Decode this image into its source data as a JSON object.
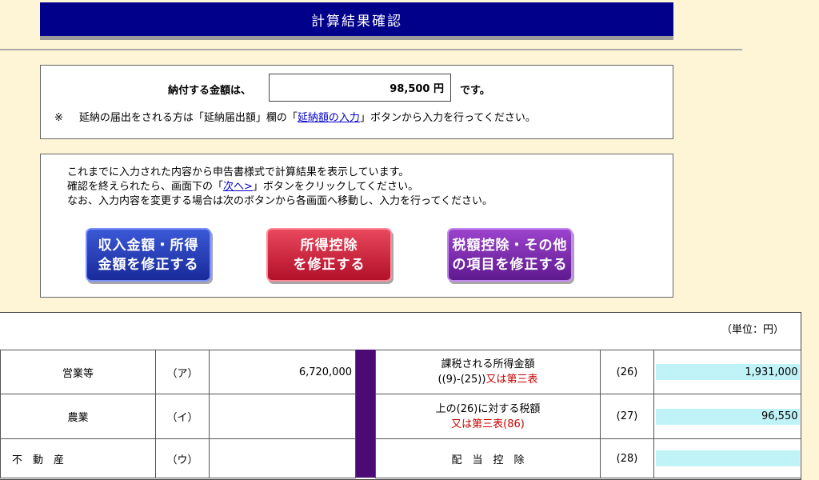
{
  "header": {
    "title": "計算結果確認"
  },
  "payment": {
    "label": "納付する金額は、",
    "amount": "98,500 円",
    "suffix": "です。"
  },
  "note": {
    "mark": "※",
    "before": "延納の届出をされる方は「延納届出額」欄の「",
    "link": "延納額の入力",
    "after": "」ボタンから入力を行ってください。"
  },
  "info": {
    "line1": "これまでに入力された内容から申告書様式で計算結果を表示しています。",
    "line2_before": "確認を終えられたら、画面下の「",
    "line2_link": "次へ>",
    "line2_after": "」ボタンをクリックしてください。",
    "line3": "なお、入力内容を変更する場合は次のボタンから各画面へ移動し、入力を行ってください。"
  },
  "buttons": {
    "income": {
      "line1": "収入金額・所得",
      "line2": "金額を修正する"
    },
    "deduction": {
      "line1": "所得控除",
      "line2": "を修正する"
    },
    "tax": {
      "line1": "税額控除・その他",
      "line2": "の項目を修正する"
    }
  },
  "table": {
    "unit": "（単位：円）",
    "left_rows": [
      {
        "label": "営業等",
        "code": "（ア）",
        "value": "6,720,000"
      },
      {
        "label": "農業",
        "code": "（イ）",
        "value": ""
      },
      {
        "label": "不　動　産",
        "code": "（ウ）",
        "value": ""
      }
    ],
    "right_rows": [
      {
        "label1": "課税される所得金額",
        "label2a": "((9)-(25))",
        "label2b": "又は第三表",
        "code": "(26)",
        "value": "1,931,000"
      },
      {
        "label1": "上の(26)に対する税額",
        "label2a": "",
        "label2b": "又は第三表(86)",
        "code": "(27)",
        "value": "96,550"
      },
      {
        "label1": "配　当　控　除",
        "label2a": "",
        "label2b": "",
        "code": "(28)",
        "value": ""
      }
    ]
  },
  "colors": {
    "header_bg": "#00008b",
    "page_bg": "#fdf5d6",
    "button_income": "#1a2a9a",
    "button_deduction": "#b3102a",
    "button_tax": "#5f1a8f",
    "divider_bar": "#4b0a74",
    "highlight_cell": "#bff3f7",
    "alt_text": "#cc0000"
  }
}
